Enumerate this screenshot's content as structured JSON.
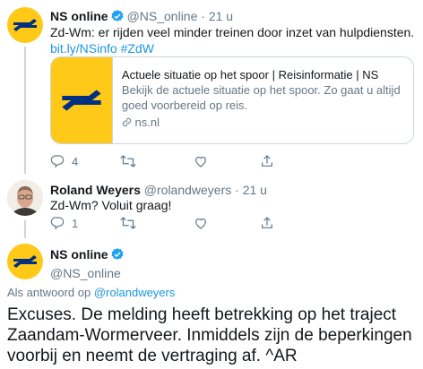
{
  "tweet1": {
    "name": "NS online",
    "handle": "@NS_online",
    "separator": "·",
    "time": "21 u",
    "text": "Zd-Wm: er rijden veel minder treinen door inzet van hulpdiensten.",
    "link": "bit.ly/NSinfo",
    "hashtag": "#ZdW",
    "card": {
      "title": "Actuele situatie op het spoor | Reisinformatie | NS",
      "description": "Bekijk de actuele situatie op het spoor. Zo gaat u altijd goed voorbereid op reis.",
      "url": "ns.nl"
    },
    "actions": {
      "replies": "4"
    }
  },
  "tweet2": {
    "name": "Roland Weyers",
    "handle": "@rolandweyers",
    "separator": "·",
    "time": "21 u",
    "text": "Zd-Wm? Voluit graag!",
    "actions": {
      "replies": "1"
    }
  },
  "main": {
    "name": "NS online",
    "handle": "@NS_online",
    "reply_prefix": "Als antwoord op",
    "reply_handle": "@rolandweyers",
    "text": "Excuses. De melding heeft betrekking op het traject Zaandam-Wormerveer. Inmiddels zijn de beperkingen voorbij en neemt de vertraging af. ^AR"
  },
  "colors": {
    "ns_yellow": "#ffc917",
    "ns_blue": "#003082",
    "twitter_blue": "#1da1f2",
    "link_blue": "#1b95e0",
    "secondary_gray": "#657786"
  },
  "icons": {
    "verified": "verified-badge-icon",
    "reply": "reply-icon",
    "retweet": "retweet-icon",
    "like": "heart-icon",
    "share": "share-icon",
    "link": "link-icon",
    "logo": "ns-logo"
  }
}
